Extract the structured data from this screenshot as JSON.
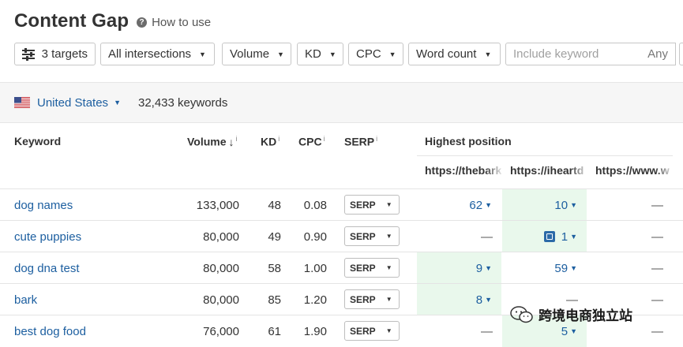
{
  "header": {
    "title": "Content Gap",
    "help_label": "How to use",
    "help_glyph": "?"
  },
  "filters": {
    "targets_label": "3 targets",
    "intersections_label": "All intersections",
    "volume_label": "Volume",
    "kd_label": "KD",
    "cpc_label": "CPC",
    "word_count_label": "Word count",
    "include_placeholder": "Include keyword",
    "include_mode": "Any"
  },
  "country_bar": {
    "country": "United States",
    "keyword_count": "32,433 keywords"
  },
  "table": {
    "columns": {
      "keyword": "Keyword",
      "volume": "Volume",
      "kd": "KD",
      "cpc": "CPC",
      "serp": "SERP",
      "highest_position": "Highest position",
      "info_glyph": "i",
      "sort_glyph": "↓"
    },
    "target_urls": [
      "https://thebark",
      "https://iheartd",
      "https://www.w"
    ],
    "rows": [
      {
        "keyword": "dog names",
        "volume": "133,000",
        "kd": "48",
        "cpc": "0.08",
        "serp": "SERP",
        "positions": [
          "62",
          "10",
          "—"
        ],
        "highlight": [
          false,
          true,
          false
        ]
      },
      {
        "keyword": "cute puppies",
        "volume": "80,000",
        "kd": "49",
        "cpc": "0.90",
        "serp": "SERP",
        "positions": [
          "—",
          "1",
          "—"
        ],
        "highlight": [
          false,
          true,
          false
        ]
      },
      {
        "keyword": "dog dna test",
        "volume": "80,000",
        "kd": "58",
        "cpc": "1.00",
        "serp": "SERP",
        "positions": [
          "9",
          "59",
          "—"
        ],
        "highlight": [
          true,
          false,
          false
        ]
      },
      {
        "keyword": "bark",
        "volume": "80,000",
        "kd": "85",
        "cpc": "1.20",
        "serp": "SERP",
        "positions": [
          "8",
          "—",
          "—"
        ],
        "highlight": [
          true,
          false,
          false
        ]
      },
      {
        "keyword": "best dog food",
        "volume": "76,000",
        "kd": "61",
        "cpc": "1.90",
        "serp": "SERP",
        "positions": [
          "—",
          "5",
          "—"
        ],
        "highlight": [
          false,
          true,
          false
        ]
      }
    ]
  },
  "watermark": {
    "text": "跨境电商独立站"
  },
  "colors": {
    "link": "#1d5fa0",
    "highlight": "#e9f8ec",
    "band": "#f6f6f6"
  }
}
